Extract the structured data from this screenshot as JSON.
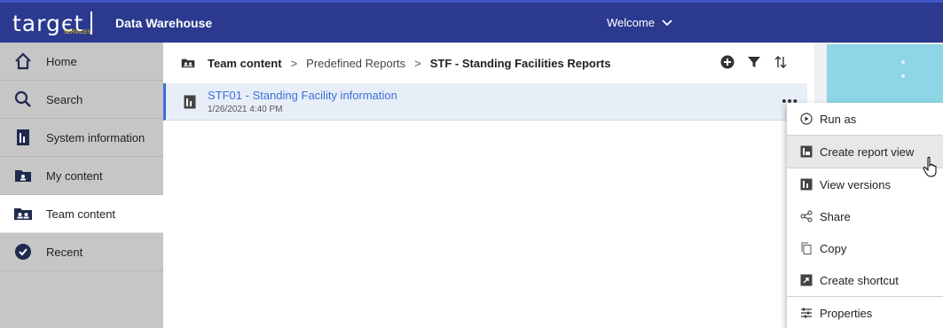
{
  "header": {
    "logo_text": "targєt",
    "logo_sub": "SERVICES",
    "app_title": "Data Warehouse",
    "welcome_label": "Welcome",
    "colors": {
      "bar": "#2b3a8f",
      "logo_accent": "#ffd200"
    }
  },
  "sidebar": {
    "items": [
      {
        "label": "Home",
        "icon": "home-icon",
        "active": false
      },
      {
        "label": "Search",
        "icon": "search-icon",
        "active": false
      },
      {
        "label": "System information",
        "icon": "report-icon",
        "active": false
      },
      {
        "label": "My content",
        "icon": "folder-user-icon",
        "active": false
      },
      {
        "label": "Team content",
        "icon": "folder-team-icon",
        "active": true
      },
      {
        "label": "Recent",
        "icon": "clock-check-icon",
        "active": false
      }
    ]
  },
  "breadcrumb": {
    "items": [
      "Team content",
      "Predefined Reports",
      "STF - Standing Facilities Reports"
    ],
    "separator": ">"
  },
  "toolbar": {
    "icons": [
      "add-icon",
      "filter-icon",
      "sort-icon"
    ]
  },
  "report": {
    "name": "STF01 - Standing Facility information",
    "date": "1/26/2021 4:40 PM",
    "more_label": "•••"
  },
  "context_menu": {
    "items": [
      {
        "label": "Run as",
        "icon": "run-icon"
      },
      {
        "label": "Create report view",
        "icon": "report-view-icon"
      },
      {
        "label": "View versions",
        "icon": "versions-icon"
      },
      {
        "label": "Share",
        "icon": "share-icon"
      },
      {
        "label": "Copy",
        "icon": "copy-icon"
      },
      {
        "label": "Create shortcut",
        "icon": "shortcut-icon"
      },
      {
        "label": "Properties",
        "icon": "properties-icon"
      }
    ],
    "hovered": "Create report view"
  }
}
